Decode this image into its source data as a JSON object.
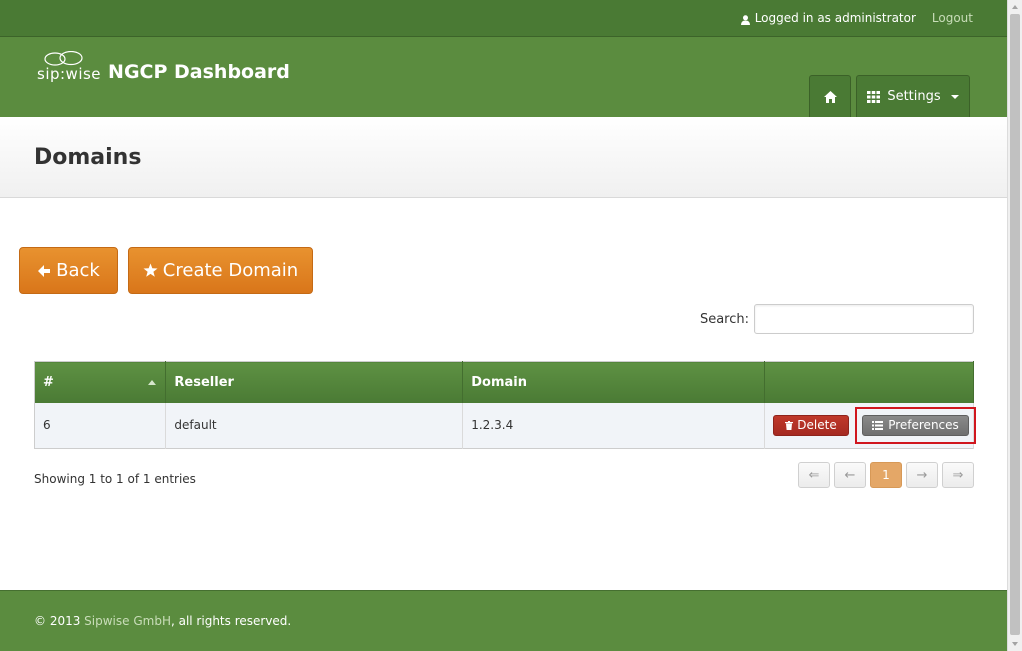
{
  "topbar": {
    "logged_in_text": "Logged in as administrator",
    "logout_label": "Logout"
  },
  "brand": {
    "logo_text": "sip:wise",
    "title": "NGCP Dashboard"
  },
  "nav": {
    "settings_label": "Settings"
  },
  "page": {
    "title": "Domains"
  },
  "actions": {
    "back_label": "Back",
    "create_label": "Create Domain"
  },
  "search": {
    "label": "Search:",
    "value": ""
  },
  "table": {
    "columns": [
      "#",
      "Reseller",
      "Domain",
      ""
    ],
    "rows": [
      {
        "id": "6",
        "reseller": "default",
        "domain": "1.2.3.4"
      }
    ],
    "delete_label": "Delete",
    "preferences_label": "Preferences"
  },
  "info_text": "Showing 1 to 1 of 1 entries",
  "pagination": {
    "first": "⇐",
    "prev": "←",
    "current": "1",
    "next": "→",
    "last": "⇒"
  },
  "footer": {
    "prefix": "© 2013 ",
    "company": "Sipwise GmbH",
    "suffix": ", all rights reserved."
  },
  "colors": {
    "green_dark": "#4a7a34",
    "green": "#5b8c3f",
    "orange": "#e08425",
    "delete_red": "#b53226",
    "highlight_red": "#d0161e"
  }
}
